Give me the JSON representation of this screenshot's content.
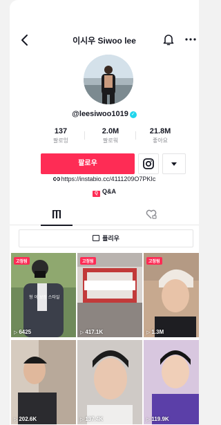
{
  "header": {
    "title": "이시우 Siwoo lee",
    "back_icon": "chevron-left-icon",
    "bell_icon": "bell-icon",
    "more_icon": "more-horizontal-icon"
  },
  "profile": {
    "username": "@leesiwoo1019",
    "verified": true,
    "stats": [
      {
        "value": "137",
        "label": "팔로잉"
      },
      {
        "value": "2.0M",
        "label": "팔로워"
      },
      {
        "value": "21.8M",
        "label": "좋아요"
      }
    ],
    "follow_label": "팔로우",
    "bio_link": "https://instabio.cc/4111209O7PKIc",
    "qa_label": "Q&A"
  },
  "tabs": [
    {
      "name": "videos",
      "icon": "grid-icon",
      "active": true
    },
    {
      "name": "liked",
      "icon": "heart-lock-icon",
      "active": false
    }
  ],
  "playlist_label": "플리우",
  "videos": [
    {
      "views": "6425",
      "badge": "고정됨"
    },
    {
      "views": "417.1K",
      "badge": "고정됨"
    },
    {
      "views": "1.3M",
      "badge": "고정됨"
    },
    {
      "views": "202.6K",
      "badge": ""
    },
    {
      "views": "137.4K",
      "badge": ""
    },
    {
      "views": "119.9K",
      "badge": ""
    }
  ],
  "colors": {
    "accent": "#fe2c55",
    "verified": "#20d5ec",
    "text": "#161823",
    "muted": "#8a8b91"
  }
}
